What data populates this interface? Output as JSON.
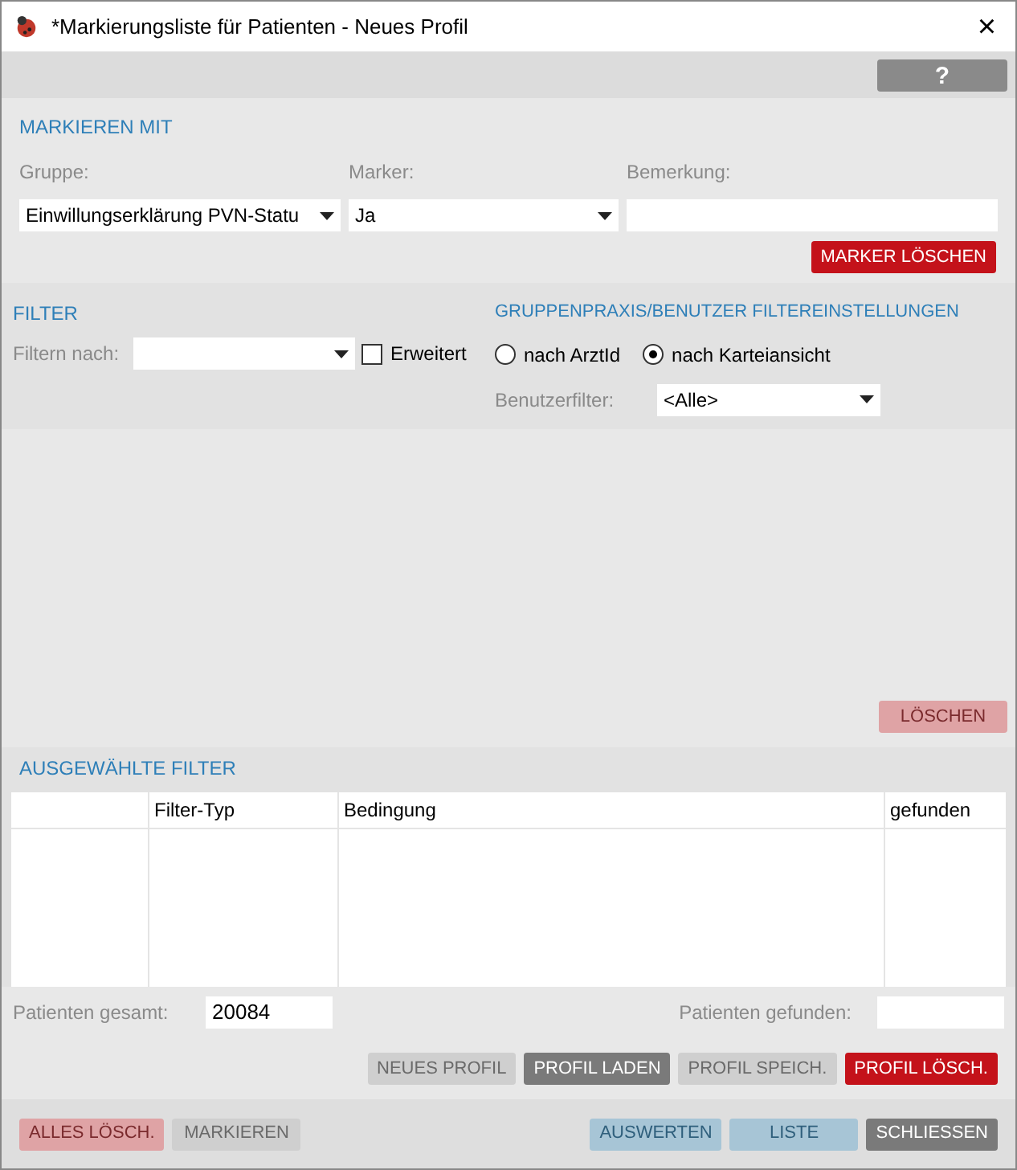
{
  "window": {
    "title": "*Markierungsliste für Patienten - Neues Profil",
    "close": "×"
  },
  "help_button": {
    "label": "?"
  },
  "markieren_mit": {
    "title": "MARKIEREN MIT",
    "fields": [
      {
        "label": "Gruppe:",
        "value": "Einwillungserklärung PVN-Statu",
        "kind": "dropdown"
      },
      {
        "label": "Marker:",
        "value": "Ja",
        "kind": "dropdown"
      },
      {
        "label": "Bemerkung:",
        "kind": "text"
      }
    ],
    "button": {
      "label": "MARKER LÖSCHEN",
      "kind": "danger",
      "disabled": false
    }
  },
  "filter": {
    "title": "FILTER",
    "label": "Filtern nach:",
    "checkbox": {
      "label": "Erweitert",
      "checked": false
    }
  },
  "gruppenpraxis": {
    "title": "GRUPPENPRAXIS/BENUTZER FILTEREINSTELLUNGEN",
    "radios": [
      {
        "label": "nach ArztId",
        "selected": false
      },
      {
        "label": "nach Karteiansicht",
        "selected": true
      }
    ],
    "benutzerfilter": {
      "label": "Benutzerfilter:",
      "value": "<Alle>"
    }
  },
  "loeschen_button": {
    "label": "LÖSCHEN",
    "kind": "danger",
    "disabled": true
  },
  "ausgewaehlte_filter": {
    "title": "AUSGEWÄHLTE FILTER",
    "columns": [
      "Filter-Typ",
      "Bedingung",
      "gefunden"
    ]
  },
  "patienten_gesamt": {
    "label": "Patienten gesamt:",
    "value": "20084"
  },
  "patienten_gefunden": {
    "label": "Patienten gefunden:"
  },
  "profile_buttons": [
    {
      "label": "NEUES PROFIL",
      "kind": "neutral",
      "disabled": true
    },
    {
      "label": "PROFIL LADEN",
      "kind": "neutral",
      "disabled": false
    },
    {
      "label": "PROFIL SPEICH.",
      "kind": "neutral",
      "disabled": true
    },
    {
      "label": "PROFIL LÖSCH.",
      "kind": "danger",
      "disabled": false
    }
  ],
  "footer_left": [
    {
      "label": "ALLES LÖSCH.",
      "kind": "danger",
      "disabled": true
    },
    {
      "label": "MARKIEREN",
      "kind": "neutral",
      "disabled": true
    }
  ],
  "footer_right": [
    {
      "label": "AUSWERTEN",
      "kind": "primary",
      "disabled": true
    },
    {
      "label": "LISTE",
      "kind": "primary",
      "disabled": true
    },
    {
      "label": "SCHLIESSEN",
      "kind": "neutral",
      "disabled": false
    }
  ]
}
